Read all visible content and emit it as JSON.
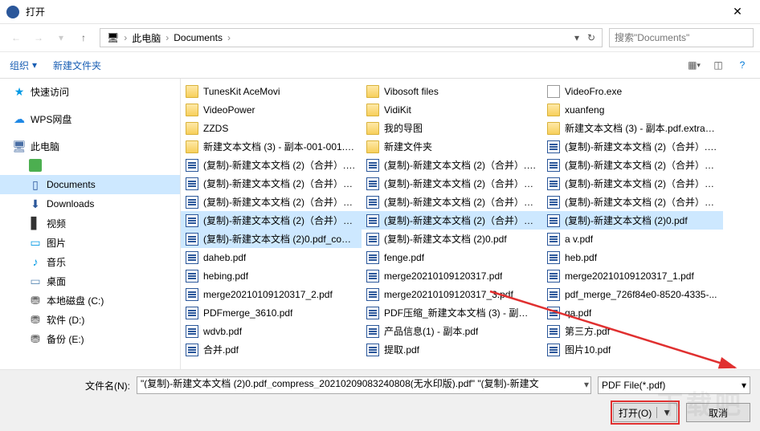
{
  "title": "打开",
  "nav": {
    "segments": [
      "此电脑",
      "Documents"
    ],
    "search_placeholder": "搜索\"Documents\""
  },
  "toolbar": {
    "organize": "组织",
    "newfolder": "新建文件夹"
  },
  "sidebar": [
    {
      "name": "快速访问",
      "icon": "star",
      "child": false
    },
    {
      "name": "WPS网盘",
      "icon": "cloud",
      "child": false
    },
    {
      "name": "此电脑",
      "icon": "pc",
      "child": false
    },
    {
      "name": "",
      "icon": "green",
      "child": true
    },
    {
      "name": "Documents",
      "icon": "doc",
      "child": true,
      "selected": true
    },
    {
      "name": "Downloads",
      "icon": "down",
      "child": true
    },
    {
      "name": "视频",
      "icon": "vid",
      "child": true
    },
    {
      "name": "图片",
      "icon": "img",
      "child": true
    },
    {
      "name": "音乐",
      "icon": "music",
      "child": true
    },
    {
      "name": "桌面",
      "icon": "desk",
      "child": true
    },
    {
      "name": "本地磁盘 (C:)",
      "icon": "disk",
      "child": true
    },
    {
      "name": "软件 (D:)",
      "icon": "disk",
      "child": true
    },
    {
      "name": "备份 (E:)",
      "icon": "disk",
      "child": true
    }
  ],
  "files": {
    "col1": [
      {
        "t": "folder",
        "n": "TunesKit AceMovi"
      },
      {
        "t": "folder",
        "n": "VideoPower"
      },
      {
        "t": "folder",
        "n": "ZZDS"
      },
      {
        "t": "folder",
        "n": "新建文本文档 (3) - 副本-001-001.p..."
      },
      {
        "t": "pdf",
        "n": "(复制)-新建文本文档 (2)（合并）.p..."
      },
      {
        "t": "pdf",
        "n": "(复制)-新建文本文档 (2)（合并）_c..."
      },
      {
        "t": "pdf",
        "n": "(复制)-新建文本文档 (2)（合并）_加..."
      },
      {
        "t": "pdf",
        "n": "(复制)-新建文本文档 (2)（合并）_已...",
        "sel": true
      },
      {
        "t": "pdf",
        "n": "(复制)-新建文本文档 (2)0.pdf_com...",
        "sel": true
      },
      {
        "t": "pdf",
        "n": "daheb.pdf"
      },
      {
        "t": "pdf",
        "n": "hebing.pdf"
      },
      {
        "t": "pdf",
        "n": "merge20210109120317_2.pdf"
      },
      {
        "t": "pdf",
        "n": "PDFmerge_3610.pdf"
      },
      {
        "t": "pdf",
        "n": "wdvb.pdf"
      },
      {
        "t": "pdf",
        "n": "合并.pdf"
      }
    ],
    "col2": [
      {
        "t": "folder",
        "n": "Vibosoft files"
      },
      {
        "t": "folder",
        "n": "VidiKit"
      },
      {
        "t": "folder",
        "n": "我的导图"
      },
      {
        "t": "folder",
        "n": "新建文件夹"
      },
      {
        "t": "pdf",
        "n": "(复制)-新建文本文档 (2)（合并）.p..."
      },
      {
        "t": "pdf",
        "n": "(复制)-新建文本文档 (2)（合并）_加..."
      },
      {
        "t": "pdf",
        "n": "(复制)-新建文本文档 (2)（合并）_加..."
      },
      {
        "t": "pdf",
        "n": "(复制)-新建文本文档 (2)（合并）_已...",
        "sel": true
      },
      {
        "t": "pdf",
        "n": "(复制)-新建文本文档 (2)0.pdf"
      },
      {
        "t": "pdf",
        "n": "fenge.pdf"
      },
      {
        "t": "pdf",
        "n": "merge20210109120317.pdf"
      },
      {
        "t": "pdf",
        "n": "merge20210109120317_3.pdf"
      },
      {
        "t": "pdf",
        "n": "PDF压缩_新建文本文档 (3) - 副本_..."
      },
      {
        "t": "pdf",
        "n": "产品信息(1) - 副本.pdf"
      },
      {
        "t": "pdf",
        "n": "提取.pdf"
      }
    ],
    "col3": [
      {
        "t": "exe",
        "n": "VideoFro.exe"
      },
      {
        "t": "folder",
        "n": "xuanfeng"
      },
      {
        "t": "folder",
        "n": "新建文本文档 (3) - 副本.pdf.extract..."
      },
      {
        "t": "pdf",
        "n": "(复制)-新建文本文档 (2)（合并）.pdf"
      },
      {
        "t": "pdf",
        "n": "(复制)-新建文本文档 (2)（合并）_1..."
      },
      {
        "t": "pdf",
        "n": "(复制)-新建文本文档 (2)（合并）_加..."
      },
      {
        "t": "pdf",
        "n": "(复制)-新建文本文档 (2)（合并）_加..."
      },
      {
        "t": "pdf",
        "n": "(复制)-新建文本文档 (2)0.pdf",
        "sel": true
      },
      {
        "t": "pdf",
        "n": "a v.pdf"
      },
      {
        "t": "pdf",
        "n": "heb.pdf"
      },
      {
        "t": "pdf",
        "n": "merge20210109120317_1.pdf"
      },
      {
        "t": "pdf",
        "n": "pdf_merge_726f84e0-8520-4335-..."
      },
      {
        "t": "pdf",
        "n": "qa.pdf"
      },
      {
        "t": "pdf",
        "n": "第三方.pdf"
      },
      {
        "t": "pdf",
        "n": "图片10.pdf"
      }
    ]
  },
  "footer": {
    "filename_label": "文件名(N):",
    "filename_value": "\"(复制)-新建文本文档 (2)0.pdf_compress_20210209083240808(无水印版).pdf\" \"(复制)-新建文",
    "filetype": "PDF File(*.pdf)",
    "open": "打开(O)",
    "cancel": "取消"
  },
  "watermark": "下载吧"
}
